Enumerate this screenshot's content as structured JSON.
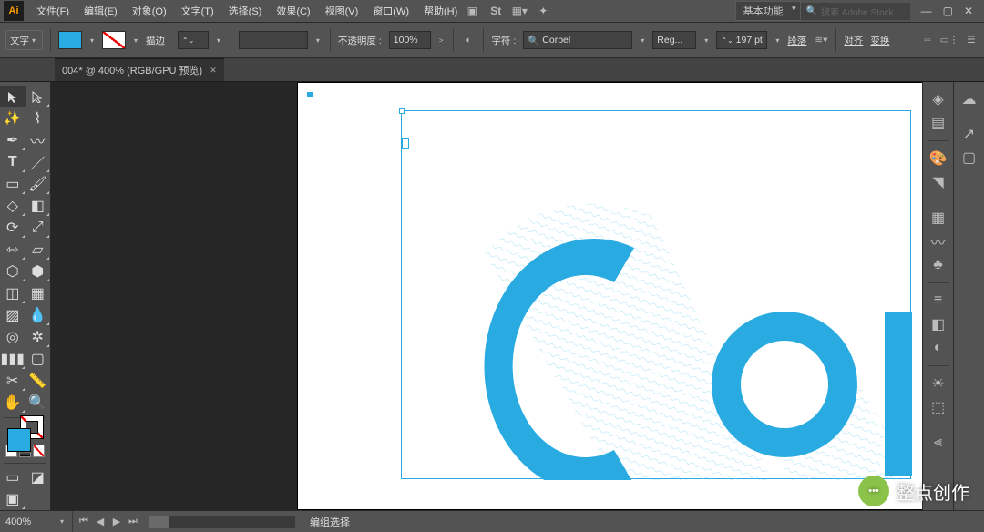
{
  "app_logo": "Ai",
  "menu": [
    "文件(F)",
    "编辑(E)",
    "对象(O)",
    "文字(T)",
    "选择(S)",
    "效果(C)",
    "视图(V)",
    "窗口(W)",
    "帮助(H)"
  ],
  "workspace": "基本功能",
  "search": {
    "placeholder": "搜索 Adobe Stock",
    "icon": "search-icon"
  },
  "window_controls": {
    "minimize": "—",
    "maximize": "▢",
    "close": "✕"
  },
  "control": {
    "context_label": "文字",
    "fill_color": "#29ABE2",
    "stroke_label": "描边 :",
    "stroke_value": "",
    "opacity_label": "不透明度 :",
    "opacity_value": "100%",
    "charset_label": "字符 :",
    "font_name": "Corbel",
    "font_style": "Reg...",
    "font_size": "197 pt",
    "para_label": "段落",
    "align_label": "对齐",
    "transform_label": "变换"
  },
  "doc_tab": {
    "title": "004* @ 400% (RGB/GPU 预览)"
  },
  "canvas": {
    "text_content": "Co",
    "text_color": "#29ABE2"
  },
  "status": {
    "zoom": "400%",
    "label": "编组选择"
  },
  "watermark": {
    "text": "整点创作",
    "icon_text": "•••"
  },
  "icons": {
    "selection": "selection-tool",
    "direct": "direct-selection-tool",
    "wand": "magic-wand-tool",
    "lasso": "lasso-tool",
    "pen": "pen-tool",
    "curv": "curvature-tool",
    "type": "type-tool",
    "line": "line-tool",
    "rect": "rectangle-tool",
    "brush": "paintbrush-tool",
    "shaper": "shaper-tool",
    "pencil": "pencil-tool",
    "eraser": "eraser-tool",
    "scissors": "scissors-tool",
    "rotate": "rotate-tool",
    "reflect": "reflect-tool",
    "scale": "scale-tool",
    "width": "width-tool",
    "freetr": "free-transform-tool",
    "puppet": "puppet-warp-tool",
    "shapeb": "shape-builder-tool",
    "livepaint": "live-paint-tool",
    "persp": "perspective-grid-tool",
    "mesh": "mesh-tool",
    "grad": "gradient-tool",
    "eyedrop": "eyedropper-tool",
    "blend": "blend-tool",
    "symbol": "symbol-sprayer-tool",
    "graph": "column-graph-tool",
    "artb": "artboard-tool",
    "slice": "slice-tool",
    "hand": "hand-tool",
    "zoom": "zoom-tool"
  }
}
